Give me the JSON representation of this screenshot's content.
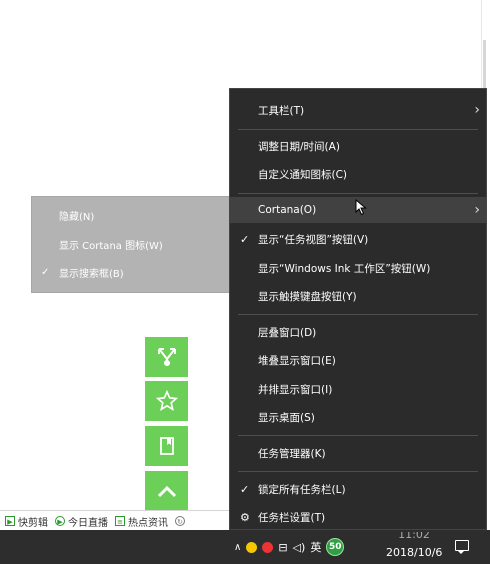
{
  "context_menu": {
    "items": [
      {
        "label": "工具栏(T)"
      },
      {
        "label": "调整日期/时间(A)"
      },
      {
        "label": "自定义通知图标(C)"
      },
      {
        "label": "Cortana(O)"
      },
      {
        "label": "显示“任务视图”按钮(V)"
      },
      {
        "label": "显示“Windows Ink 工作区”按钮(W)"
      },
      {
        "label": "显示触摸键盘按钮(Y)"
      },
      {
        "label": "层叠窗口(D)"
      },
      {
        "label": "堆叠显示窗口(E)"
      },
      {
        "label": "并排显示窗口(I)"
      },
      {
        "label": "显示桌面(S)"
      },
      {
        "label": "任务管理器(K)"
      },
      {
        "label": "锁定所有任务栏(L)"
      },
      {
        "label": "任务栏设置(T)"
      }
    ]
  },
  "cortana_submenu": {
    "items": [
      {
        "label": "隐藏(N)"
      },
      {
        "label": "显示 Cortana 图标(W)"
      },
      {
        "label": "显示搜索框(B)"
      }
    ]
  },
  "toolbar": {
    "items": [
      {
        "label": "快剪辑"
      },
      {
        "label": "今日直播"
      },
      {
        "label": "热点资讯"
      }
    ]
  },
  "taskbar": {
    "ime": "英",
    "badge": "50",
    "time": "11:02",
    "date": "2018/10/6"
  },
  "colors": {
    "menu_bg": "#2b2b2b",
    "submenu_bg": "#b3b3b3",
    "green_accent": "#6ccf57",
    "taskbar_bg": "#2d2d2d"
  }
}
